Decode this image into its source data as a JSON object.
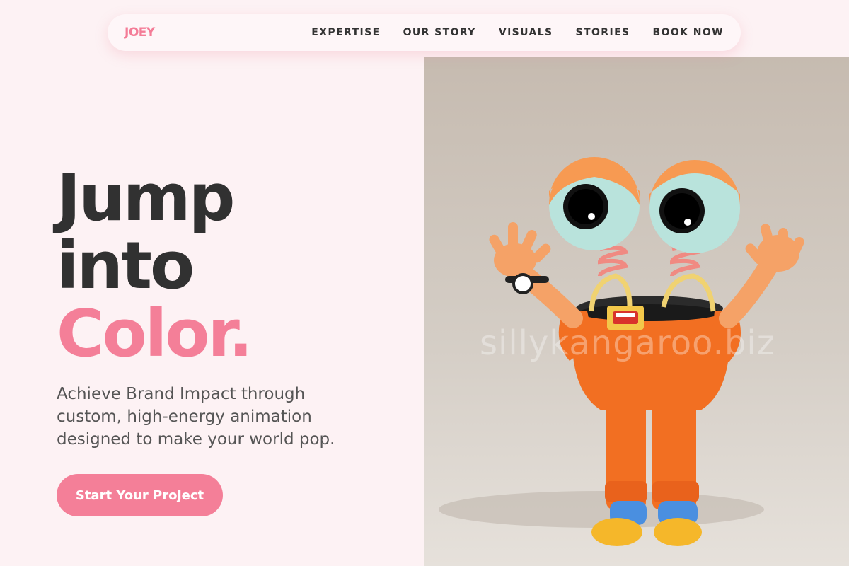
{
  "brand": {
    "logo": "JOEY"
  },
  "nav": {
    "items": [
      {
        "label": "EXPERTISE"
      },
      {
        "label": "OUR STORY"
      },
      {
        "label": "VISUALS"
      },
      {
        "label": "STORIES"
      },
      {
        "label": "BOOK NOW"
      }
    ]
  },
  "hero": {
    "title_line1": "Jump",
    "title_line2": "into",
    "title_line3": "Color.",
    "subtitle": "Achieve Brand Impact through custom, high-energy animation designed to make your world pop.",
    "cta_label": "Start Your Project"
  },
  "visual": {
    "watermark": "sillykangaroo.biz",
    "subject": "orange-cartoon-character"
  },
  "colors": {
    "accent": "#f47f98",
    "text_dark": "#313131",
    "background": "#fdf2f4"
  }
}
